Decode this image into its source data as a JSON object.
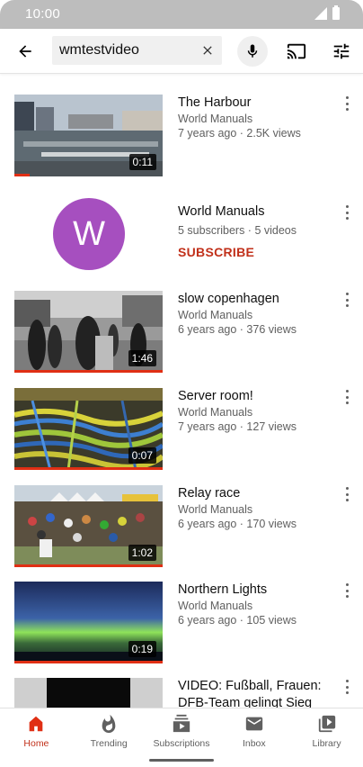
{
  "status_bar": {
    "time": "10:00"
  },
  "search": {
    "query": "wmtestvideo"
  },
  "colors": {
    "accent": "#c1301a",
    "progress": "#e02f14",
    "avatar_bg": "#a64fbf"
  },
  "results": [
    {
      "kind": "video",
      "title": "The Harbour",
      "channel": "World Manuals",
      "meta": "7 years ago · 2.5K views",
      "duration": "0:11",
      "watch_progress": 0.1,
      "thumb_scene": "harbour"
    },
    {
      "kind": "channel",
      "title": "World Manuals",
      "avatar_letter": "W",
      "meta": "5 subscribers · 5 videos",
      "subscribe_label": "SUBSCRIBE"
    },
    {
      "kind": "video",
      "title": "slow copenhagen",
      "channel": "World Manuals",
      "meta": "6 years ago · 376 views",
      "duration": "1:46",
      "watch_progress": 1.0,
      "thumb_scene": "street"
    },
    {
      "kind": "video",
      "title": "Server room!",
      "channel": "World Manuals",
      "meta": "7 years ago · 127 views",
      "duration": "0:07",
      "watch_progress": 1.0,
      "thumb_scene": "cables"
    },
    {
      "kind": "video",
      "title": "Relay race",
      "channel": "World Manuals",
      "meta": "6 years ago · 170 views",
      "duration": "1:02",
      "watch_progress": 1.0,
      "thumb_scene": "crowd"
    },
    {
      "kind": "video",
      "title": "Northern Lights",
      "channel": "World Manuals",
      "meta": "6 years ago · 105 views",
      "duration": "0:19",
      "watch_progress": 1.0,
      "thumb_scene": "aurora"
    },
    {
      "kind": "video",
      "title": "VIDEO: Fußball, Frauen: DFB-Team gelingt Sieg",
      "channel": "",
      "meta": "",
      "duration": "",
      "watch_progress": 0,
      "thumb_scene": "dark"
    }
  ],
  "bottom_nav": [
    {
      "label": "Home",
      "icon": "home-icon",
      "active": true
    },
    {
      "label": "Trending",
      "icon": "flame-icon",
      "active": false
    },
    {
      "label": "Subscriptions",
      "icon": "subscriptions-icon",
      "active": false
    },
    {
      "label": "Inbox",
      "icon": "mail-icon",
      "active": false
    },
    {
      "label": "Library",
      "icon": "library-icon",
      "active": false
    }
  ]
}
